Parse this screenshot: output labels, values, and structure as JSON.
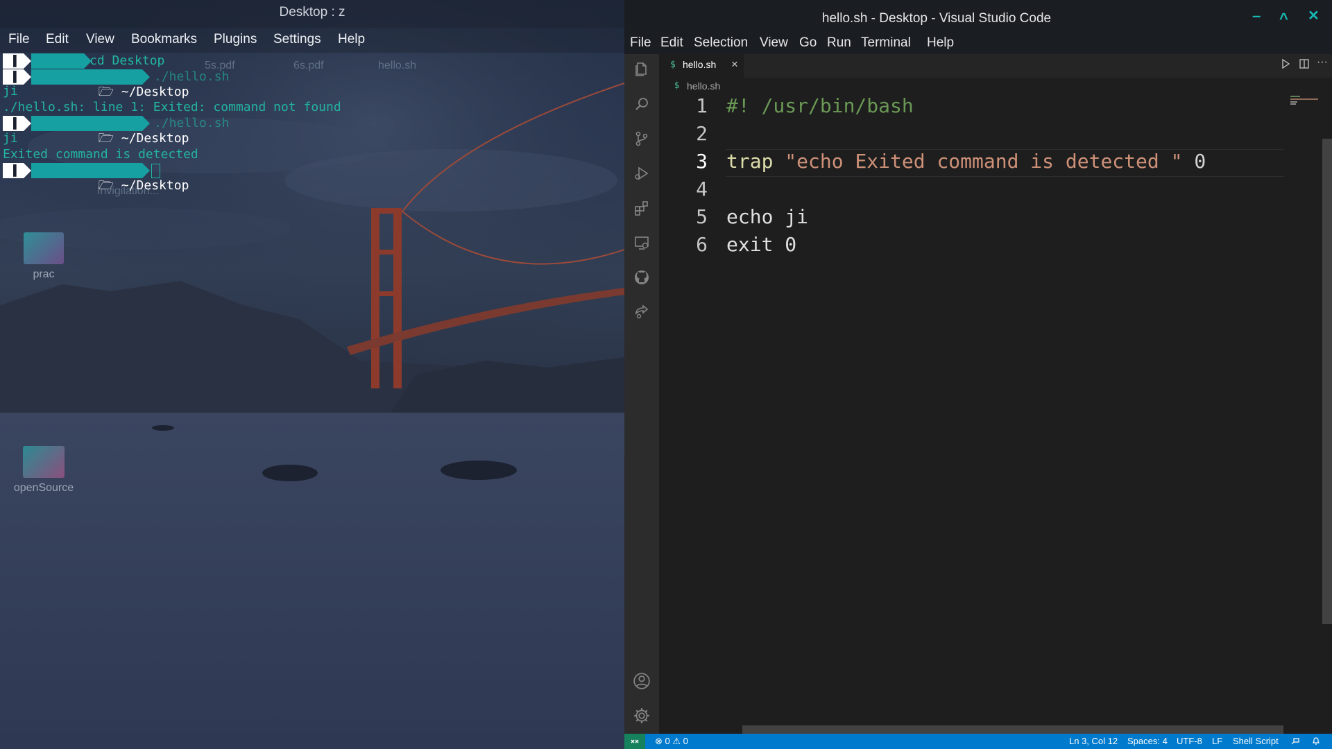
{
  "konsole": {
    "title": "Desktop : z",
    "menu": [
      "File",
      "Edit",
      "View",
      "Bookmarks",
      "Plugins",
      "Settings",
      "Help"
    ],
    "prompts": {
      "home": "~",
      "desktop": "~/Desktop"
    },
    "commands": [
      "cd Desktop",
      "./hello.sh",
      "./hello.sh"
    ],
    "outputs": [
      "ji",
      "./hello.sh: line 1: Exited: command not found",
      "ji",
      "Exited command is detected"
    ],
    "ghost_files": [
      "5s.pdf",
      "6s.pdf",
      "hello.sh",
      "Invigilation..."
    ],
    "icons": {
      "home": "home-icon",
      "folder": "folder-icon"
    }
  },
  "desktop": {
    "icons": [
      {
        "label": "prac",
        "icon": "folder-icon"
      },
      {
        "label": "openSource",
        "icon": "folder-icon"
      }
    ]
  },
  "vscode": {
    "window_title": "hello.sh - Desktop - Visual Studio Code",
    "menu": [
      "File",
      "Edit",
      "Selection",
      "View",
      "Go",
      "Run",
      "Terminal",
      "Help"
    ],
    "window_controls": {
      "minimize": "–",
      "maximize": "^",
      "close": "✕"
    },
    "activity_bar": [
      "explorer-icon",
      "search-icon",
      "source-control-icon",
      "run-debug-icon",
      "extensions-icon",
      "remote-explorer-icon",
      "github-icon",
      "live-share-icon",
      "account-icon",
      "settings-gear-icon"
    ],
    "tab": {
      "filename": "hello.sh",
      "icon": "$",
      "close": "×"
    },
    "breadcrumb": {
      "icon": "$",
      "filename": "hello.sh"
    },
    "code_lines": [
      {
        "number": "1",
        "text": "#! /usr/bin/bash"
      },
      {
        "number": "2",
        "text": ""
      },
      {
        "number": "3",
        "keyword": "trap",
        "string": "\"echo Exited command is detected \"",
        "arg": "0"
      },
      {
        "number": "4",
        "text": ""
      },
      {
        "number": "5",
        "text": "echo ji"
      },
      {
        "number": "6",
        "text": "exit 0"
      }
    ],
    "status": {
      "errors": "0",
      "warnings": "0",
      "position": "Ln 3, Col 12",
      "spaces": "Spaces: 4",
      "encoding": "UTF-8",
      "eol": "LF",
      "language": "Shell Script"
    },
    "colors": {
      "accent": "#007acc",
      "comment": "#6a9955",
      "string": "#ce9178",
      "text": "#d4d4d4",
      "window_controls": "#18b9b4"
    }
  }
}
